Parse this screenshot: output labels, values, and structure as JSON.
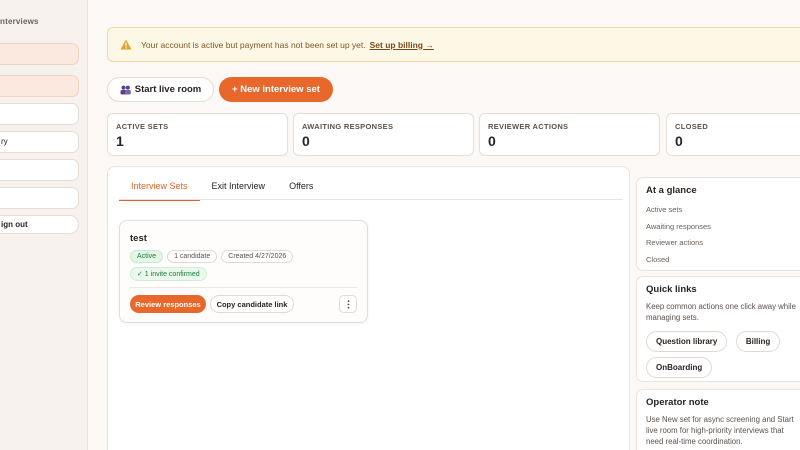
{
  "sidebar": {
    "title": "nterviews",
    "items": [
      {
        "label": "",
        "tint": true
      },
      {
        "label": "",
        "tint": true
      },
      {
        "label": "",
        "tint": false
      },
      {
        "label": "ry",
        "tint": false
      },
      {
        "label": "",
        "tint": false
      },
      {
        "label": "",
        "tint": false
      }
    ],
    "sign_out": "ign out"
  },
  "banner": {
    "message": "Your account is active but payment has not been set up yet.",
    "link": "Set up billing →",
    "icon": "warning-icon"
  },
  "actions": {
    "live_room": "Start live room",
    "new_set": "+ New interview set"
  },
  "stats": [
    {
      "label": "ACTIVE SETS",
      "value": "1"
    },
    {
      "label": "AWAITING RESPONSES",
      "value": "0"
    },
    {
      "label": "REVIEWER ACTIONS",
      "value": "0"
    },
    {
      "label": "CLOSED",
      "value": "0"
    }
  ],
  "tabs": [
    {
      "label": "Interview Sets",
      "active": true
    },
    {
      "label": "Exit Interview",
      "active": false
    },
    {
      "label": "Offers",
      "active": false
    }
  ],
  "set_card": {
    "title": "test",
    "status": "Active",
    "candidates": "1 candidate",
    "created": "Created 4/27/2026",
    "invites": "✓ 1 invite confirmed",
    "review_btn": "Review responses",
    "copy_btn": "Copy candidate link"
  },
  "glance": {
    "title": "At a glance",
    "rows": [
      "Active sets",
      "Awaiting responses",
      "Reviewer actions",
      "Closed"
    ]
  },
  "quick_links": {
    "title": "Quick links",
    "desc": "Keep common actions one click away while managing sets.",
    "links": [
      "Question library",
      "Billing",
      "OnBoarding"
    ]
  },
  "operator_note": {
    "title": "Operator note",
    "text": "Use New set for async screening and Start live room for high-priority interviews that need real-time coordination."
  },
  "colors": {
    "accent": "#e8672a",
    "banner_bg": "#fdf7e6",
    "success": "#1f7a3b"
  }
}
